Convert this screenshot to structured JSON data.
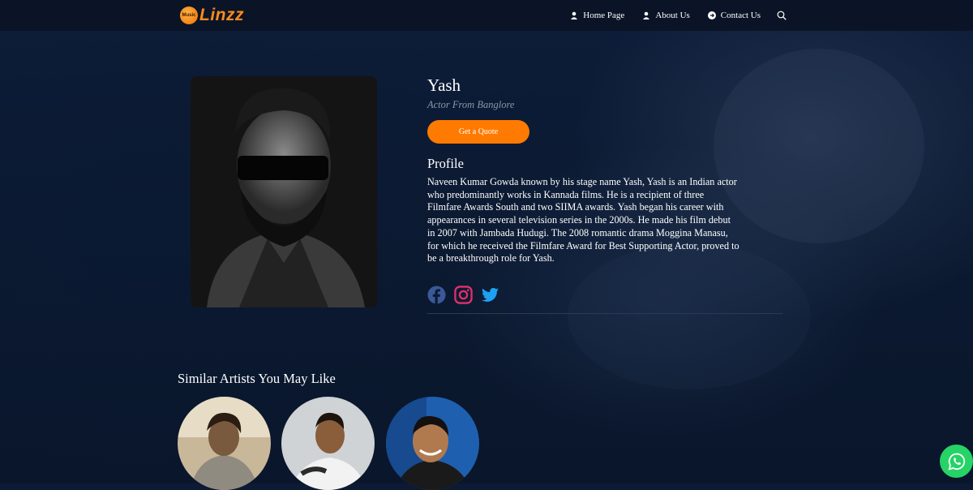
{
  "brand": {
    "name": "Linzz",
    "mark": "Music"
  },
  "nav": [
    {
      "label": "Home Page"
    },
    {
      "label": "About Us"
    },
    {
      "label": "Contact Us"
    }
  ],
  "artist": {
    "name": "Yash",
    "subtitle": "Actor From Banglore",
    "cta": "Get a Quote",
    "profile_heading": "Profile",
    "profile_text": "Naveen Kumar Gowda known by his stage name Yash, Yash is an Indian actor who predominantly works in Kannada films. He is a recipient of three Filmfare Awards South and two SIIMA awards. Yash began his career with appearances in several television series in the 2000s. He made his film debut in 2007 with Jambada Hudugi. The 2008 romantic drama Moggina Manasu, for which he received the Filmfare Award for Best Supporting Actor, proved to be a breakthrough role for Yash."
  },
  "socials": [
    "facebook-icon",
    "instagram-icon",
    "twitter-icon"
  ],
  "similar": {
    "heading": "Similar Artists You May Like",
    "count": 3
  },
  "colors": {
    "accent": "#ff7a00",
    "background": "#0c1a33",
    "whatsapp": "#25d366"
  }
}
